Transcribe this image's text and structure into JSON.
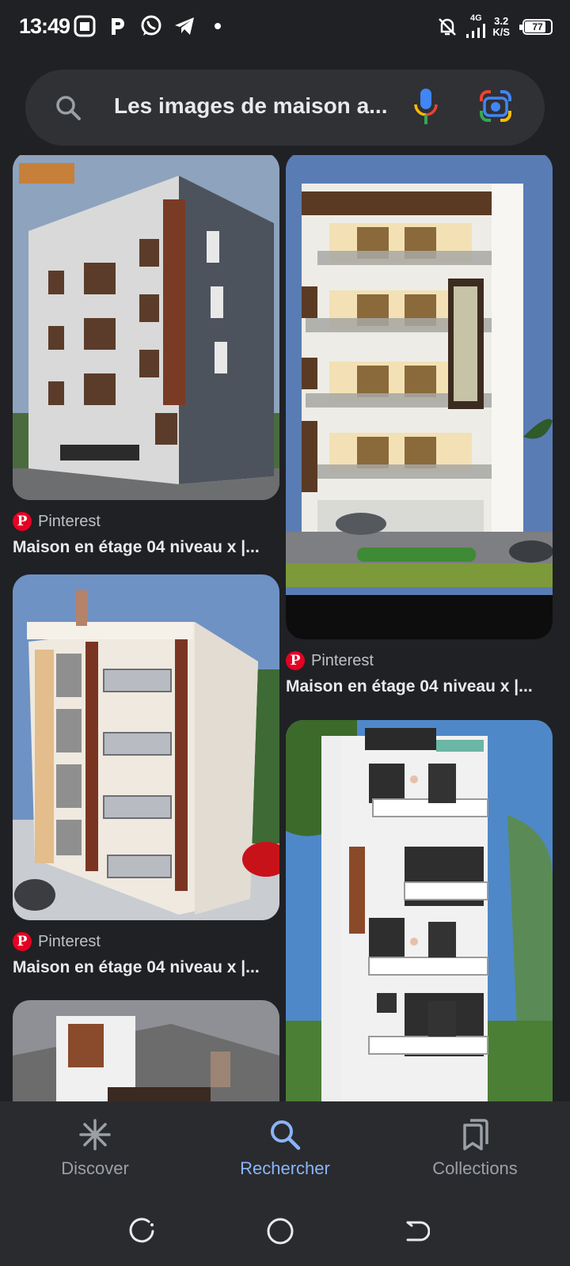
{
  "status_bar": {
    "time": "13:49",
    "network": "4G",
    "speed_value": "3.2",
    "speed_unit": "K/S",
    "battery": "77",
    "battery_level": 0.77
  },
  "search": {
    "query": "Les images de maison a..."
  },
  "results": {
    "left": [
      {
        "source": "Pinterest",
        "title": "Maison en étage 04 niveau x |..."
      },
      {
        "source": "Pinterest",
        "title": "Maison en étage 04 niveau x |..."
      }
    ],
    "right": [
      {
        "source": "Pinterest",
        "title": "Maison en étage 04 niveau x |..."
      }
    ]
  },
  "bottom_nav": {
    "items": [
      {
        "label": "Discover",
        "icon": "asterisk-icon"
      },
      {
        "label": "Rechercher",
        "icon": "search-icon"
      },
      {
        "label": "Collections",
        "icon": "bookmarks-icon"
      }
    ],
    "active": "Rechercher"
  },
  "colors": {
    "background": "#202124",
    "search_bar": "#303134",
    "accent": "#8ab4f8",
    "pinterest": "#e60023"
  }
}
